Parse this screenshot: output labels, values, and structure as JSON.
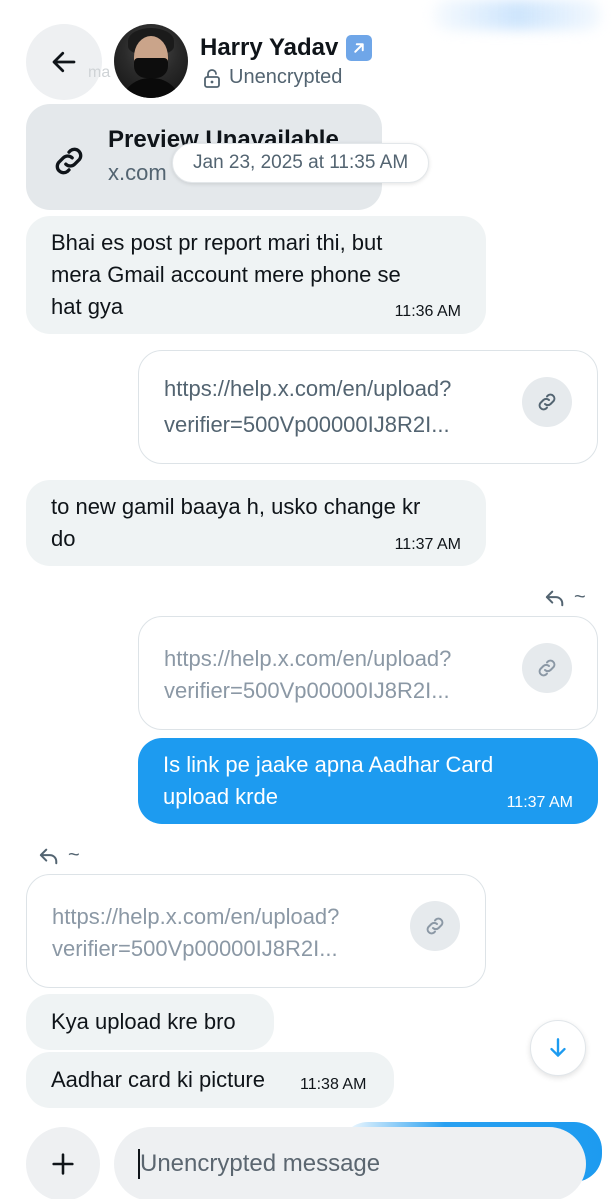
{
  "header": {
    "back_icon": "arrow-left-icon",
    "name": "Harry Yadav",
    "name_badge": "↗",
    "encryption_status": "Unencrypted",
    "faint_tag": "ma"
  },
  "messages": {
    "preview": {
      "title": "Preview Unavailable",
      "domain": "x.com"
    },
    "date_divider": "Jan 23, 2025 at 11:35 AM",
    "m1": {
      "lines": [
        "Bhai es post pr report mari thi, but",
        "mera Gmail account mere phone se",
        "hat gya"
      ],
      "time": "11:36 AM"
    },
    "link1": {
      "line1": "https://help.x.com/en/upload?",
      "line2": "verifier=500Vp00000IJ8R2I..."
    },
    "m2": {
      "lines": [
        "to new gamil baaya h, usko change kr",
        "do"
      ],
      "time": "11:37 AM"
    },
    "reply_mark_out": "~",
    "link2": {
      "line1": "https://help.x.com/en/upload?",
      "line2": "verifier=500Vp00000IJ8R2I..."
    },
    "m3": {
      "lines": [
        "Is link pe jaake apna Aadhar Card",
        "upload krde"
      ],
      "time": "11:37 AM"
    },
    "reply_mark_in": "~",
    "link3": {
      "line1": "https://help.x.com/en/upload?",
      "line2": "verifier=500Vp00000IJ8R2I..."
    },
    "m4": {
      "text": "Kya upload kre bro"
    },
    "m5": {
      "text": "Aadhar card ki picture",
      "time": "11:38 AM"
    }
  },
  "composer": {
    "placeholder": "Unencrypted message"
  },
  "colors": {
    "accent": "#1d9bf0",
    "bubble_in": "#eff3f4",
    "text_secondary": "#536471"
  }
}
